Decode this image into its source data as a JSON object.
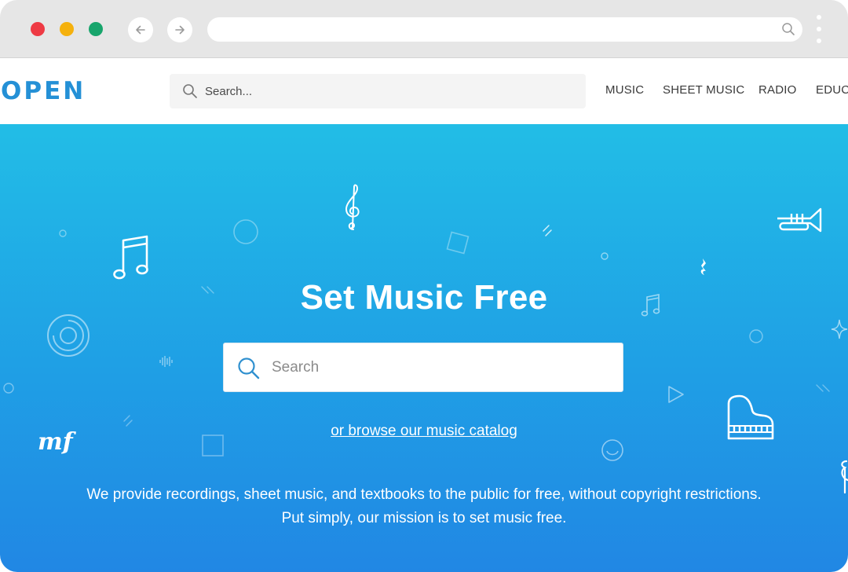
{
  "browser": {
    "window_controls": [
      "close",
      "minimize",
      "maximize"
    ],
    "nav_icons": [
      "arrow-left-icon",
      "arrow-right-icon"
    ],
    "url": "",
    "url_icon": "search-icon",
    "menu_icon": "more-vertical-icon",
    "colors": {
      "close": "#ee3a44",
      "minimize": "#f5b10d",
      "maximize": "#18a56c",
      "chrome": "#e6e6e6"
    }
  },
  "header": {
    "logo": "OPEN",
    "search": {
      "placeholder": "Search...",
      "value": "",
      "icon": "search-icon"
    },
    "nav": [
      {
        "label": "MUSIC"
      },
      {
        "label": "SHEET MUSIC"
      },
      {
        "label": "RADIO"
      },
      {
        "label": "EDUCA"
      }
    ],
    "colors": {
      "logo": "#2490d6"
    }
  },
  "hero": {
    "title": "Set Music Free",
    "search": {
      "placeholder": "Search",
      "value": "",
      "icon": "search-icon"
    },
    "browse_link": "or browse our music catalog",
    "mission": "We provide recordings, sheet music, and textbooks to the public for free, without copyright restrictions. Put simply, our mission is to set music free.",
    "decorations": {
      "icons": [
        "treble-clef-icon",
        "beamed-notes-icon",
        "trumpet-icon",
        "quarter-rest-icon",
        "small-notes-icon",
        "vinyl-icon",
        "sound-wave-icon",
        "mezzo-forte-icon",
        "play-icon",
        "piano-icon",
        "smiley-icon",
        "sparkle-icon",
        "circle-icon",
        "square-icon",
        "slash-icon"
      ],
      "mf_text": "mf"
    },
    "colors": {
      "gradient_top": "#22bde6",
      "gradient_bottom": "#2187e4",
      "text": "#ffffff"
    }
  }
}
